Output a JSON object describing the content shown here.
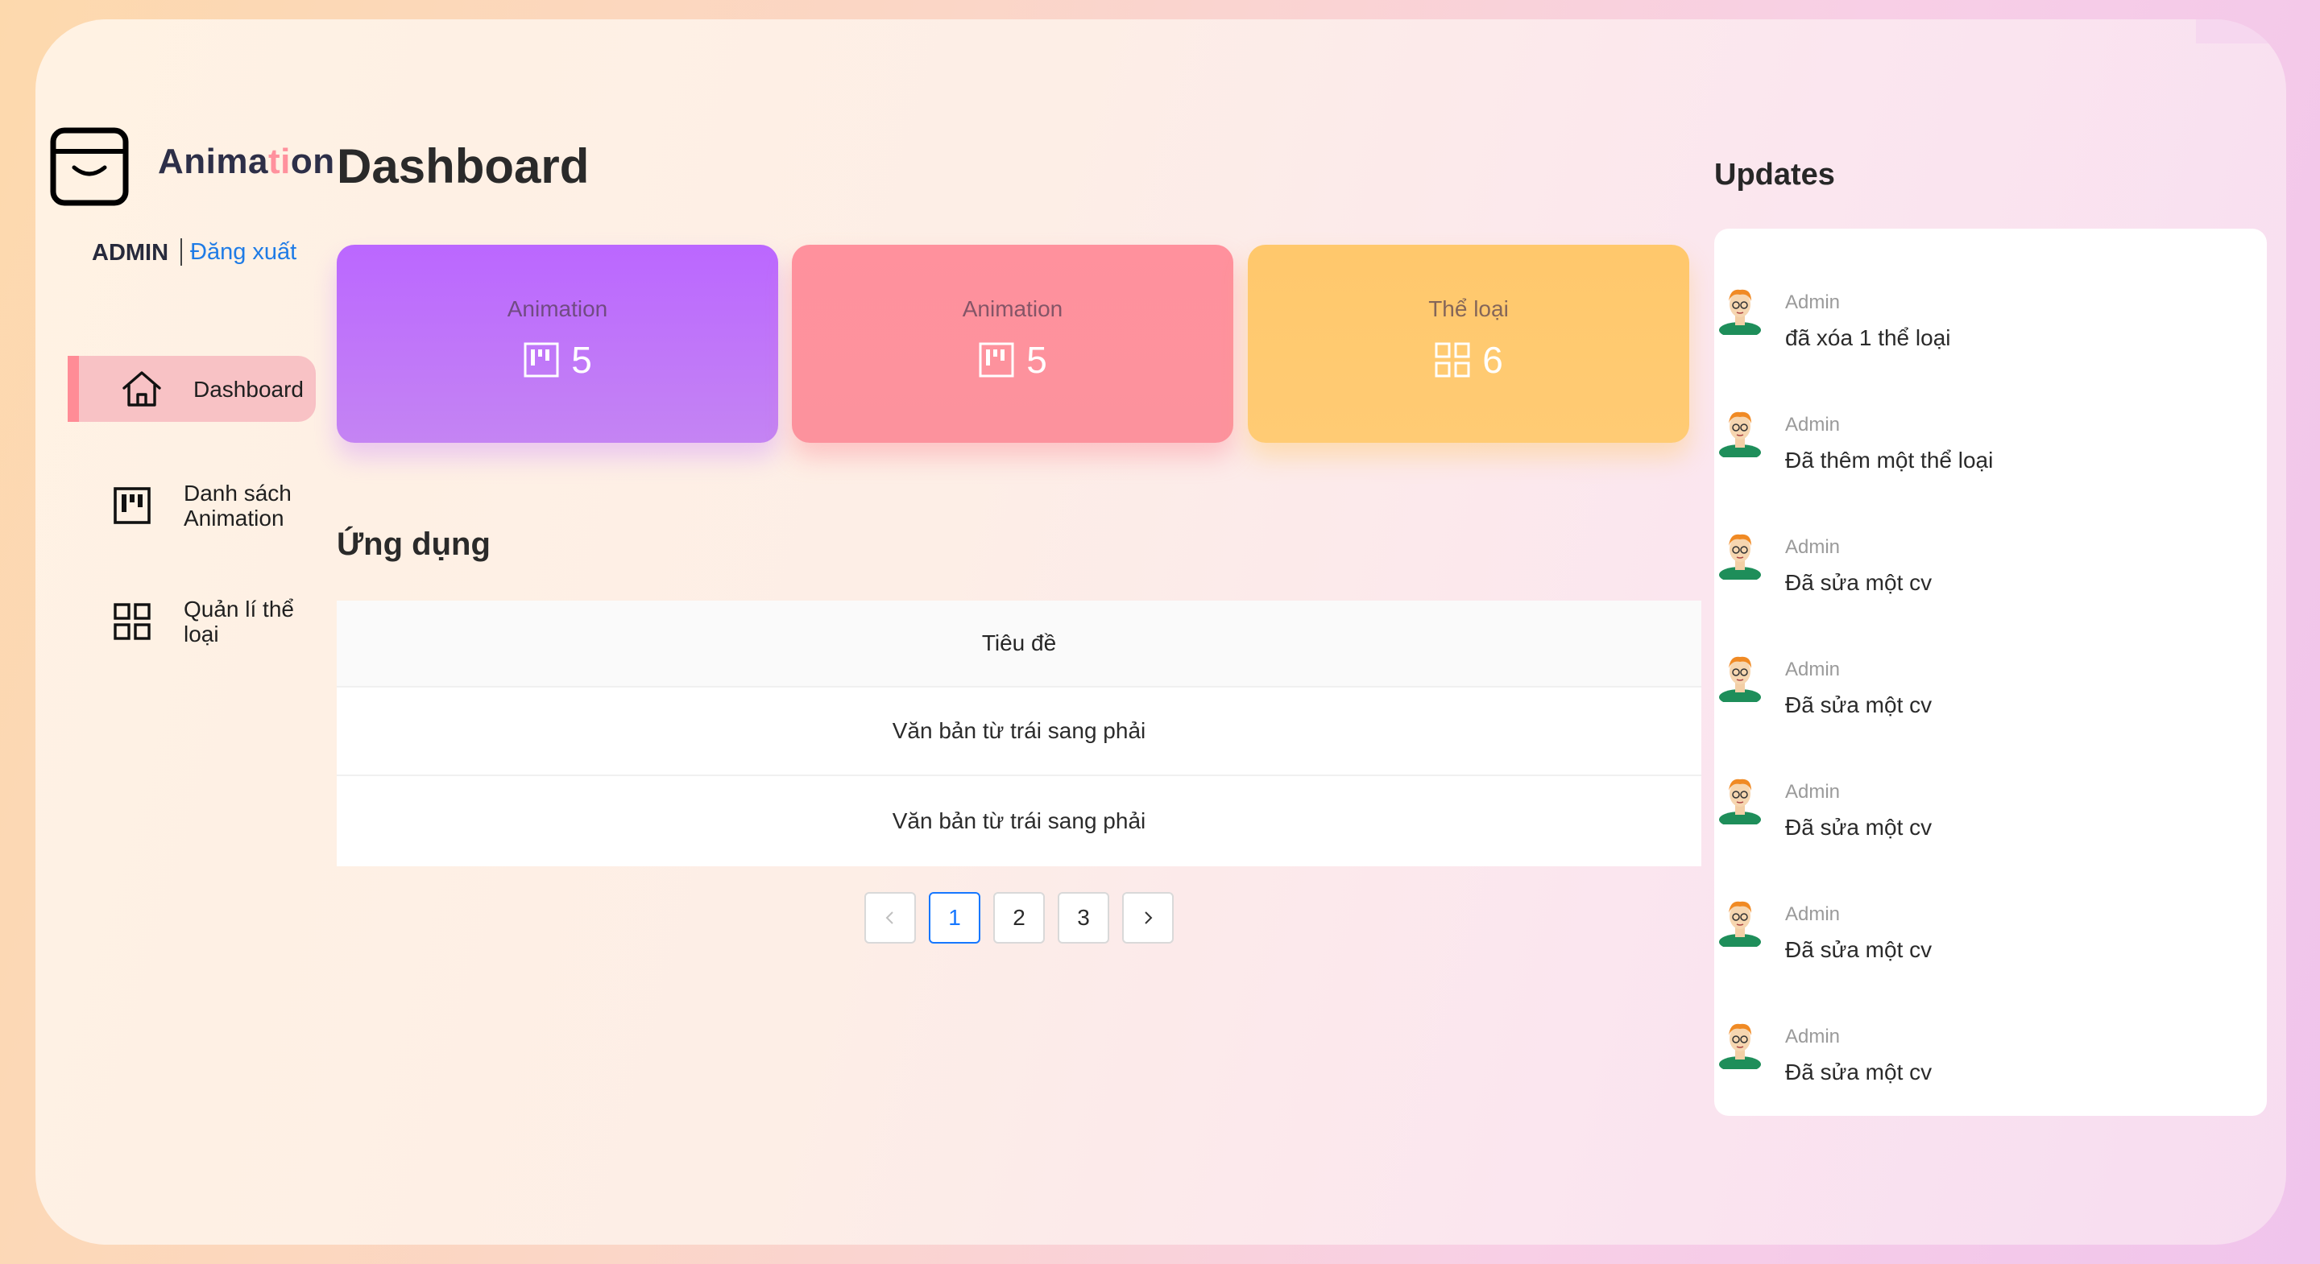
{
  "brand": {
    "prefix": "Anima",
    "accent": "ti",
    "suffix": "on"
  },
  "user": {
    "name": "ADMIN",
    "logout_label": "Đăng xuất"
  },
  "sidebar": {
    "items": [
      {
        "label": "Dashboard",
        "icon": "home-icon",
        "active": true
      },
      {
        "label": "Danh sách Animation",
        "icon": "kanban-icon",
        "active": false
      },
      {
        "label": "Quản lí thể loại",
        "icon": "grid-icon",
        "active": false
      }
    ]
  },
  "page": {
    "title": "Dashboard"
  },
  "cards": [
    {
      "title": "Animation",
      "value": "5",
      "icon": "kanban-icon",
      "color": "#bb67ff"
    },
    {
      "title": "Animation",
      "value": "5",
      "icon": "kanban-icon",
      "color": "#ff919d"
    },
    {
      "title": "Thể loại",
      "value": "6",
      "icon": "grid-icon",
      "color": "#ffca71"
    }
  ],
  "apps": {
    "title": "Ứng dụng",
    "columns": [
      "Tiêu đề"
    ],
    "rows": [
      [
        "Văn bản từ trái sang phải"
      ],
      [
        "Văn bản từ trái sang phải"
      ]
    ]
  },
  "pagination": {
    "pages": [
      "1",
      "2",
      "3"
    ],
    "current": "1"
  },
  "updates": {
    "title": "Updates",
    "items": [
      {
        "name": "Admin",
        "message": "đã xóa 1 thể loại"
      },
      {
        "name": "Admin",
        "message": "Đã thêm một thể loại"
      },
      {
        "name": "Admin",
        "message": "Đã sửa một cv"
      },
      {
        "name": "Admin",
        "message": "Đã sửa một cv"
      },
      {
        "name": "Admin",
        "message": "Đã sửa một cv"
      },
      {
        "name": "Admin",
        "message": "Đã sửa một cv"
      },
      {
        "name": "Admin",
        "message": "Đã sửa một cv"
      }
    ]
  }
}
